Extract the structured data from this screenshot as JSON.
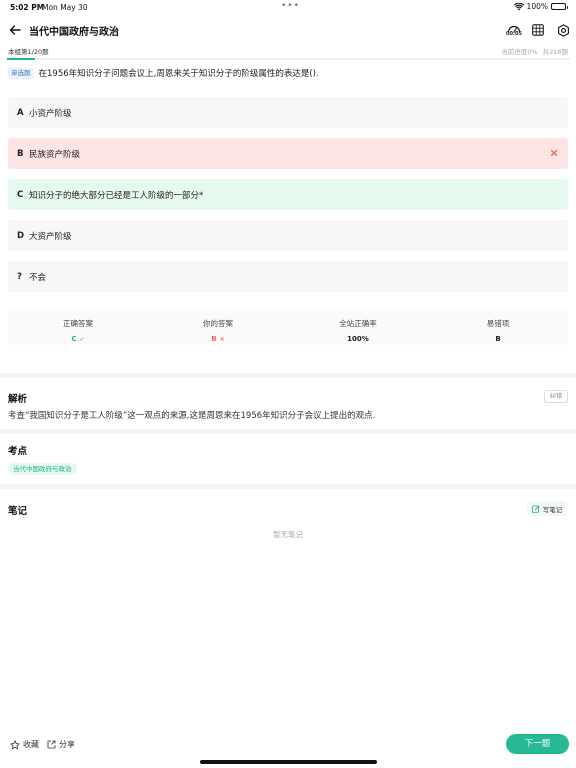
{
  "status_bar": {
    "time": "5:02 PM",
    "date": "Mon May 30",
    "battery": "100%"
  },
  "header": {
    "title": "当代中国政府与政治",
    "timer": "00:05"
  },
  "progress": {
    "question_number": "本组第1/20题",
    "current_progress": "当前进度0%",
    "total": "共218题",
    "fraction": 0.05
  },
  "question": {
    "type": "单选题",
    "text": "在1956年知识分子问题会议上,周恩来关于知识分子的阶级属性的表达是()."
  },
  "options": [
    {
      "letter": "A",
      "text": "小资产阶级",
      "state": "normal"
    },
    {
      "letter": "B",
      "text": "民族资产阶级",
      "state": "wrong"
    },
    {
      "letter": "C",
      "text": "知识分子的绝大部分已经是工人阶级的一部分*",
      "state": "correct"
    },
    {
      "letter": "D",
      "text": "大资产阶级",
      "state": "normal"
    },
    {
      "letter": "?",
      "text": "不会",
      "state": "normal"
    }
  ],
  "summary": {
    "correct_label": "正确答案",
    "correct_value": "C",
    "yours_label": "你的答案",
    "yours_value": "B",
    "rate_label": "全站正确率",
    "rate_value": "100%",
    "error_label": "易错项",
    "error_value": "B"
  },
  "analysis": {
    "title": "解析",
    "report_label": "纠错",
    "text": "考查“我国知识分子是工人阶级”这一观点的来源,这是周恩来在1956年知识分子会议上提出的观点."
  },
  "topic": {
    "title": "考点",
    "tag": "当代中国政府与政治"
  },
  "notes": {
    "title": "笔记",
    "write_label": "写笔记",
    "empty_text": "暂无笔记"
  },
  "bottom": {
    "favorite_label": "收藏",
    "share_label": "分享",
    "next_label": "下一题"
  },
  "colors": {
    "accent": "#27b995",
    "wrong": "#f2675b",
    "wrong_bg": "#fde4e4",
    "correct_bg": "#e6f9ee",
    "tag_blue": "#3e7ec9"
  }
}
